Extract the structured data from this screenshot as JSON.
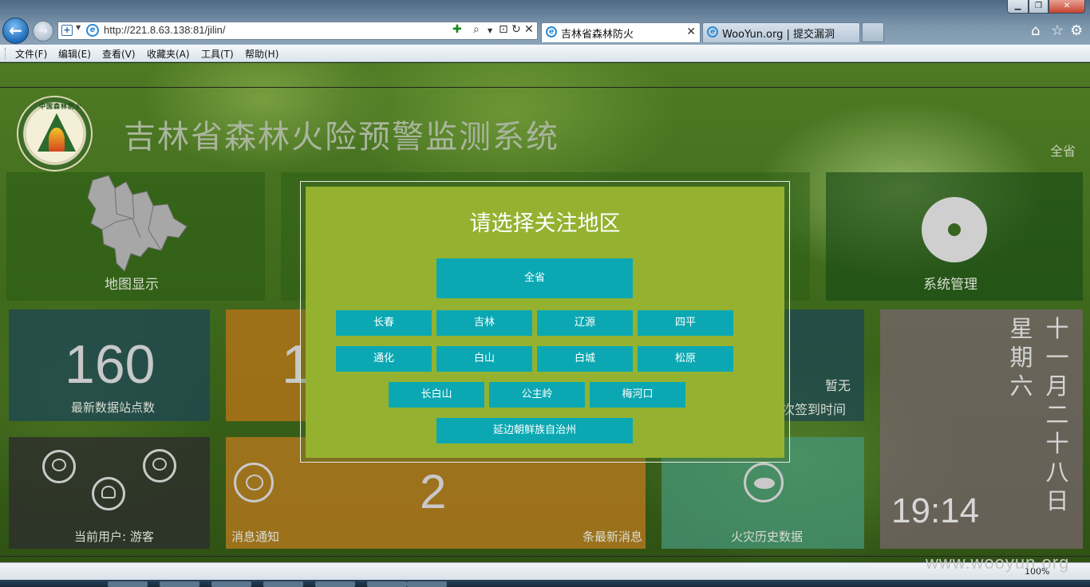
{
  "browser": {
    "address": "http://221.8.63.138:81/jilin/",
    "tabs": [
      {
        "label": "吉林省森林防火",
        "active": true
      },
      {
        "label": "WooYun.org | 提交漏洞",
        "active": false
      }
    ],
    "menu": [
      "文件(F)",
      "编辑(E)",
      "查看(V)",
      "收藏夹(A)",
      "工具(T)",
      "帮助(H)"
    ],
    "zoom": "100%"
  },
  "header": {
    "title": "吉林省森林火险预警监测系统",
    "province_link": "全省",
    "logo_text": "中国森林防火"
  },
  "tiles": {
    "map_label": "地图显示",
    "system_label": "系统管理",
    "stations_count": "160",
    "stations_label": "最新数据站点数",
    "orange_value": "1",
    "checkin_status": "暂无",
    "checkin_label": "次签到时间",
    "user_label": "当前用户: 游客",
    "notify_label": "消息通知",
    "notify_count": "2",
    "notify_suffix": "条最新消息",
    "fire_label": "火灾历史数据",
    "weekday_chars": [
      "星",
      "期",
      "六"
    ],
    "date_chars": [
      "十",
      "一",
      "月",
      "二",
      "十",
      "八",
      "日"
    ],
    "clock": "19:14"
  },
  "modal": {
    "title": "请选择关注地区",
    "province_btn": "全省",
    "row1": [
      "长春",
      "吉林",
      "辽源",
      "四平"
    ],
    "row2": [
      "通化",
      "白山",
      "白城",
      "松原"
    ],
    "row3": [
      "长白山",
      "公主岭",
      "梅河口"
    ],
    "last_btn": "延边朝鲜族自治州"
  },
  "watermark": "www.wooyun.org",
  "colors": {
    "modal_bg": "#94b230",
    "button_bg": "#0ba8b3",
    "title_text": "#a9b59c"
  }
}
